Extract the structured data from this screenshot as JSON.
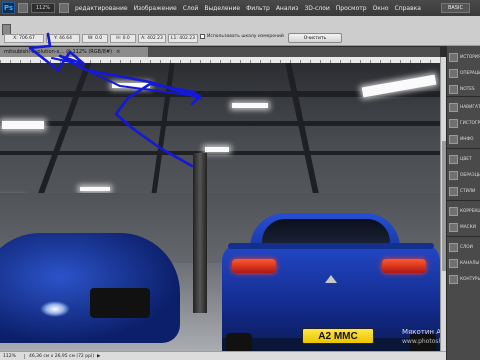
{
  "app": {
    "logo": "Ps",
    "zoom": "112%",
    "workspace_button": "BASIC"
  },
  "menu": [
    {
      "label": "редактирование"
    },
    {
      "label": "Изображение"
    },
    {
      "label": "Слой"
    },
    {
      "label": "Выделение"
    },
    {
      "label": "Фильтр"
    },
    {
      "label": "Анализ"
    },
    {
      "label": "3D-слои"
    },
    {
      "label": "Просмотр"
    },
    {
      "label": "Окно"
    },
    {
      "label": "Справка"
    }
  ],
  "options": {
    "x": "X: 706.67",
    "y": "Y: 46.64",
    "w": "W: 0.0",
    "h": "H: 0.0",
    "angle": "A: 402.23",
    "length": "L1: 402.23",
    "use_scale_label": "Использовать шкалу измерений",
    "clear_button": "Очистить"
  },
  "document": {
    "tab_title": "mitsubishi-evolution-x...  @ 112% (RGB/8#)",
    "tab_close": "×"
  },
  "image": {
    "license_plate": "A2 MMC",
    "watermark_line1": "Мякотин Антон",
    "watermark_line2": "www.photoshop-..."
  },
  "status": {
    "zoom": "112%",
    "doc_info": "46,36 см x 26,95 см (72 ppi)",
    "arrow": "▶"
  },
  "panels": [
    {
      "label": "ИСТОРИЯ",
      "icon": "history-icon"
    },
    {
      "label": "ОПЕРАЦИИ",
      "icon": "actions-icon"
    },
    {
      "label": "NOTES",
      "icon": "notes-icon"
    },
    {
      "label": "НАВИГАТОР",
      "icon": "navigator-icon"
    },
    {
      "label": "ГИСТОГРАММА",
      "icon": "histogram-icon"
    },
    {
      "label": "ИНФО",
      "icon": "info-icon"
    },
    {
      "label": "ЦВЕТ",
      "icon": "color-icon"
    },
    {
      "label": "ОБРАЗЦЫ",
      "icon": "swatches-icon"
    },
    {
      "label": "СТИЛИ",
      "icon": "styles-icon"
    },
    {
      "label": "КОРРЕКЦИЯ",
      "icon": "adjustments-icon"
    },
    {
      "label": "МАСКИ",
      "icon": "masks-icon"
    },
    {
      "label": "СЛОИ",
      "icon": "layers-icon"
    },
    {
      "label": "КАНАЛЫ",
      "icon": "channels-icon"
    },
    {
      "label": "КОНТУРЫ",
      "icon": "paths-icon"
    }
  ]
}
